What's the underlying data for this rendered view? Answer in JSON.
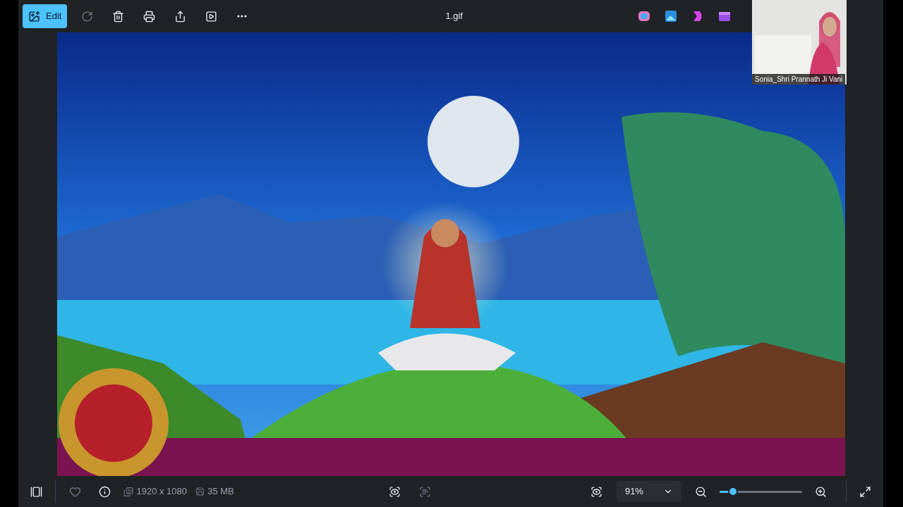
{
  "toolbar": {
    "edit_button": "Edit",
    "file_name": "1.gif"
  },
  "video_tile": {
    "name": "Sonia_Shri Prannath Ji Vani"
  },
  "status_bar": {
    "favorite": false,
    "dimensions": "1920 x 1080",
    "file_size": "35 MB",
    "zoom_value": "91%",
    "level": 0.16
  }
}
